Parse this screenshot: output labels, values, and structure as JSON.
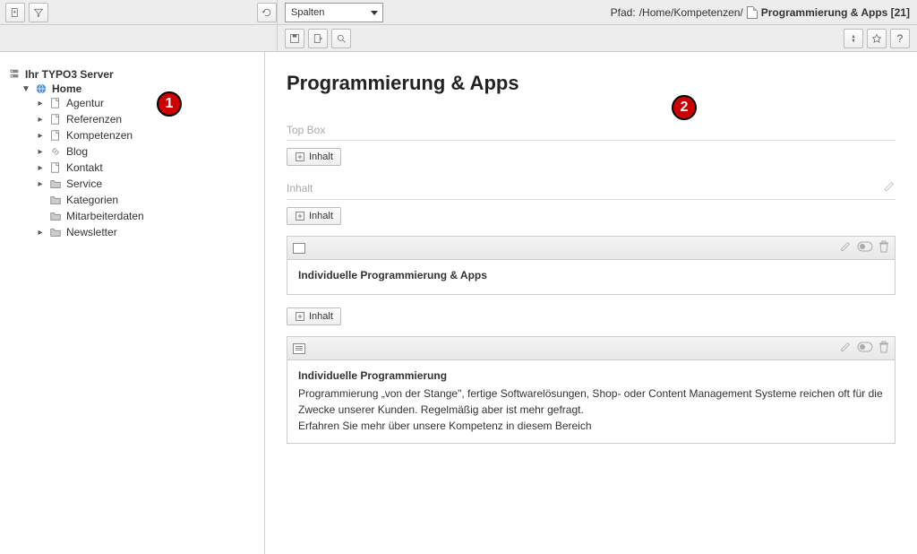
{
  "toolbar": {
    "select_label": "Spalten",
    "path_prefix": "Pfad: ",
    "path_crumbs": "/Home/Kompetenzen/",
    "path_title": "Programmierung & Apps [21]"
  },
  "tree": {
    "root": "Ihr TYPO3 Server",
    "home": "Home",
    "items": [
      "Agentur",
      "Referenzen",
      "Kompetenzen",
      "Blog",
      "Kontakt",
      "Service",
      "Kategorien",
      "Mitarbeiterdaten",
      "Newsletter"
    ]
  },
  "page": {
    "title": "Programmierung & Apps",
    "sections": {
      "topbox": {
        "label": "Top Box",
        "add_btn": "Inhalt"
      },
      "inhalt": {
        "label": "Inhalt",
        "add_btn": "Inhalt"
      }
    },
    "elements": [
      {
        "title": "Individuelle Programmierung & Apps",
        "body": ""
      },
      {
        "title": "Individuelle Programmierung",
        "body": "Programmierung „von der Stange\", fertige Softwarelösungen, Shop- oder Content Management Systeme reichen oft für die Zwecke unserer Kunden. Regelmäßig aber ist mehr gefragt.\nErfahren Sie mehr über unsere Kompetenz in diesem Bereich"
      }
    ]
  },
  "annotations": {
    "a1": "1",
    "a2": "2"
  }
}
